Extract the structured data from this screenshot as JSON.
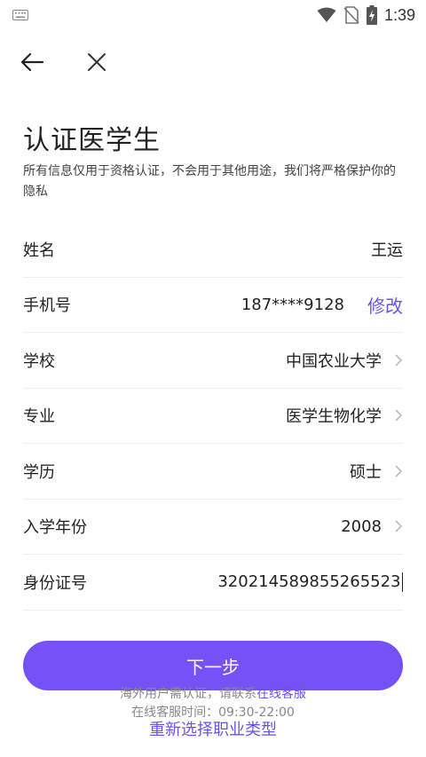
{
  "status": {
    "time": "1:39"
  },
  "nav": {
    "back_icon": "arrow-left-icon",
    "close_icon": "close-icon"
  },
  "page": {
    "title": "认证医学生",
    "subtitle": "所有信息仅用于资格认证，不会用于其他用途，我们将严格保护你的隐私"
  },
  "fields": {
    "name": {
      "label": "姓名",
      "value": "王运"
    },
    "phone": {
      "label": "手机号",
      "value": "187****9128",
      "action": "修改"
    },
    "school": {
      "label": "学校",
      "value": "中国农业大学"
    },
    "major": {
      "label": "专业",
      "value": "医学生物化学"
    },
    "degree": {
      "label": "学历",
      "value": "硕士"
    },
    "year": {
      "label": "入学年份",
      "value": "2008"
    },
    "id_number": {
      "label": "身份证号",
      "value": "320214589855265523"
    }
  },
  "footer": {
    "next_label": "下一步",
    "overseas_note": "海外用户需认证，请联系",
    "online_service": "在线客服",
    "service_hours": "在线客服时间：09:30-22:00",
    "reselect_label": "重新选择职业类型"
  },
  "colors": {
    "accent": "#7652f6",
    "link": "#6c51ef"
  }
}
